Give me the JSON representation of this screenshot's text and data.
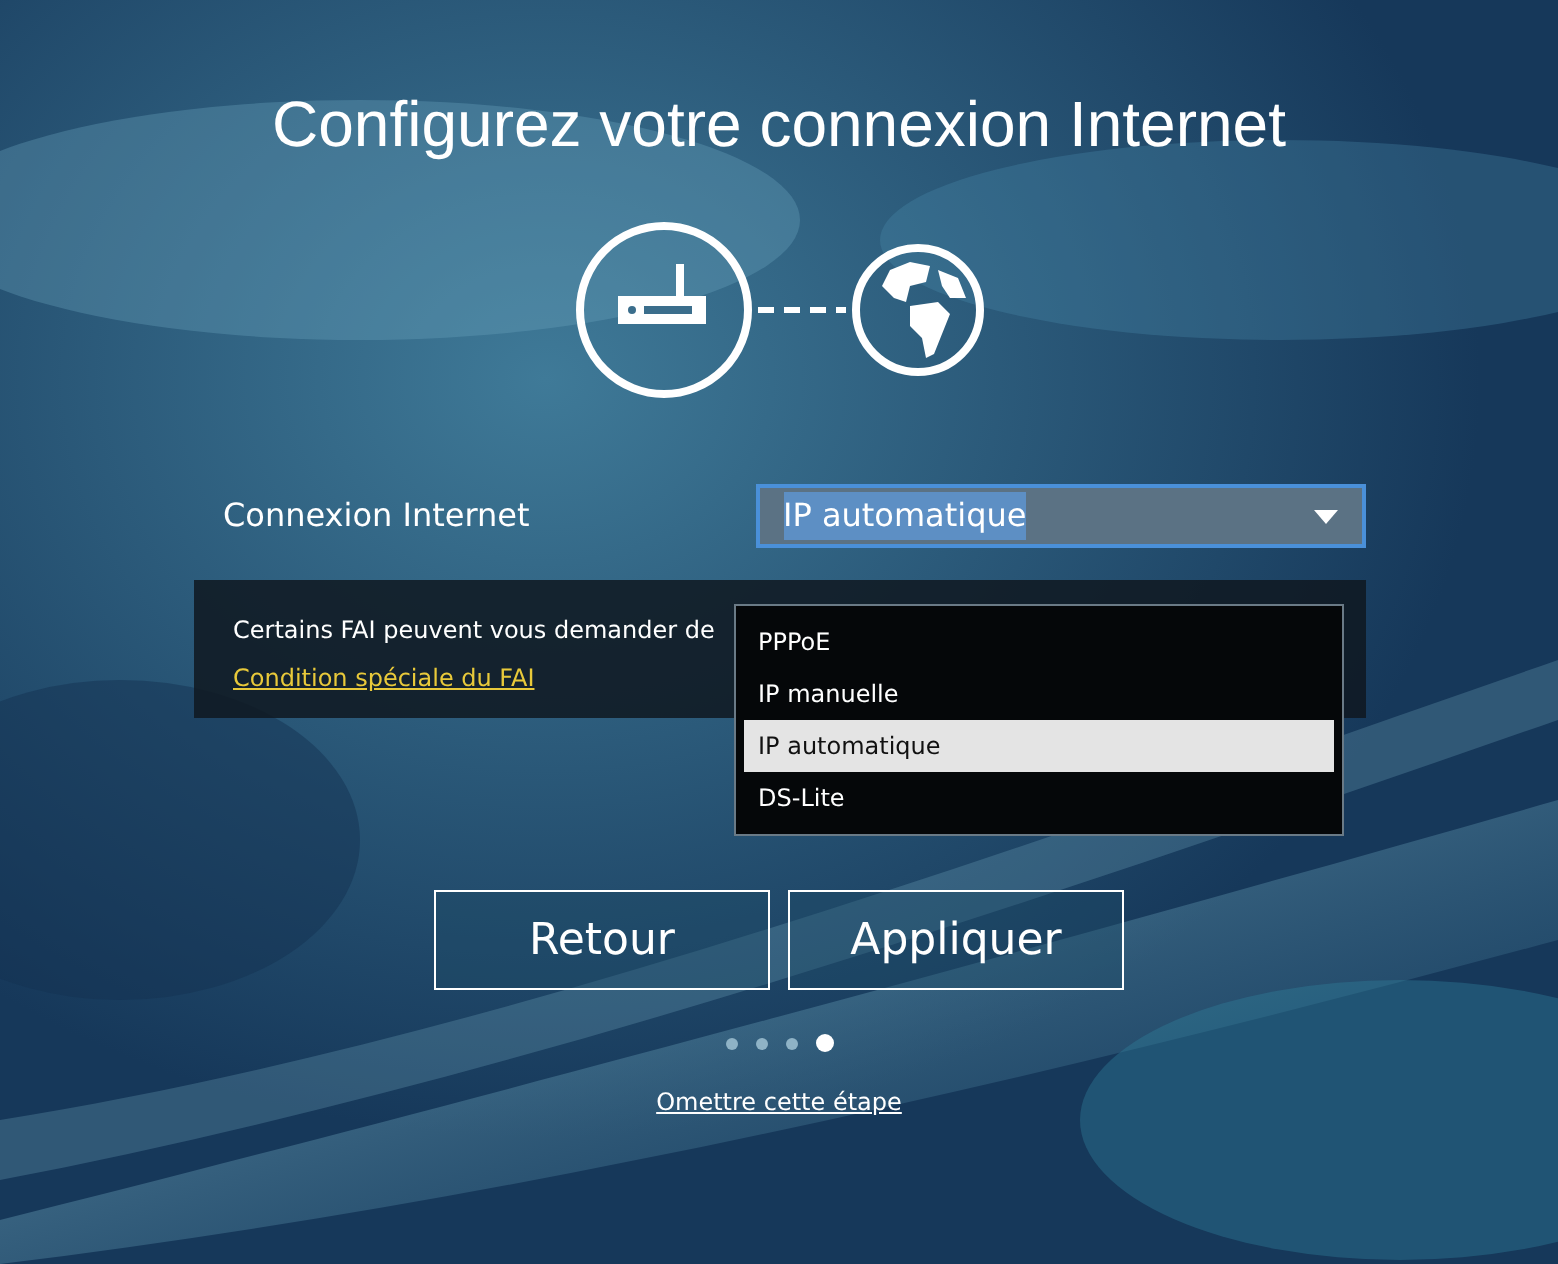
{
  "title": "Configurez votre connexion Internet",
  "connection": {
    "label": "Connexion Internet",
    "value": "IP automatique",
    "expanded": true,
    "options": [
      {
        "label": "PPPoE",
        "selected": false
      },
      {
        "label": "IP manuelle",
        "selected": false
      },
      {
        "label": "IP automatique",
        "selected": true
      },
      {
        "label": "DS-Lite",
        "selected": false
      }
    ]
  },
  "info": {
    "text": "Certains FAI peuvent vous demander de",
    "link": "Condition spéciale du FAI"
  },
  "buttons": [
    "Retour",
    "Appliquer"
  ],
  "steps": [
    {
      "selected": false
    },
    {
      "selected": false
    },
    {
      "selected": false
    },
    {
      "selected": true
    }
  ],
  "skip_link": "Omettre cette étape"
}
